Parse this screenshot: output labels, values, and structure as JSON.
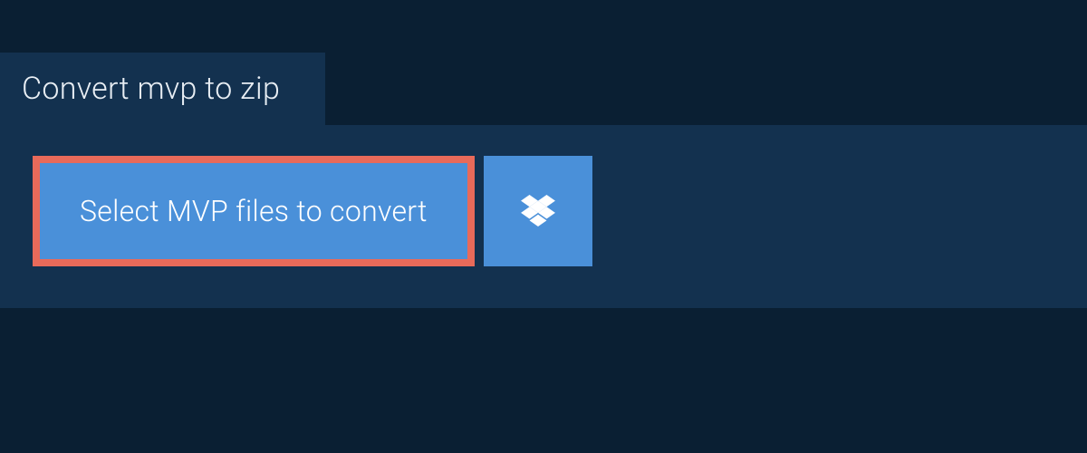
{
  "tab": {
    "title": "Convert mvp to zip"
  },
  "actions": {
    "select_files_label": "Select MVP files to convert",
    "dropbox_icon_name": "dropbox"
  },
  "colors": {
    "page_bg": "#0a1f33",
    "panel_bg": "#13314f",
    "button_bg": "#4a90d9",
    "highlight_border": "#e86a5a",
    "text_light": "#e8eef4",
    "text_white": "#ffffff"
  }
}
